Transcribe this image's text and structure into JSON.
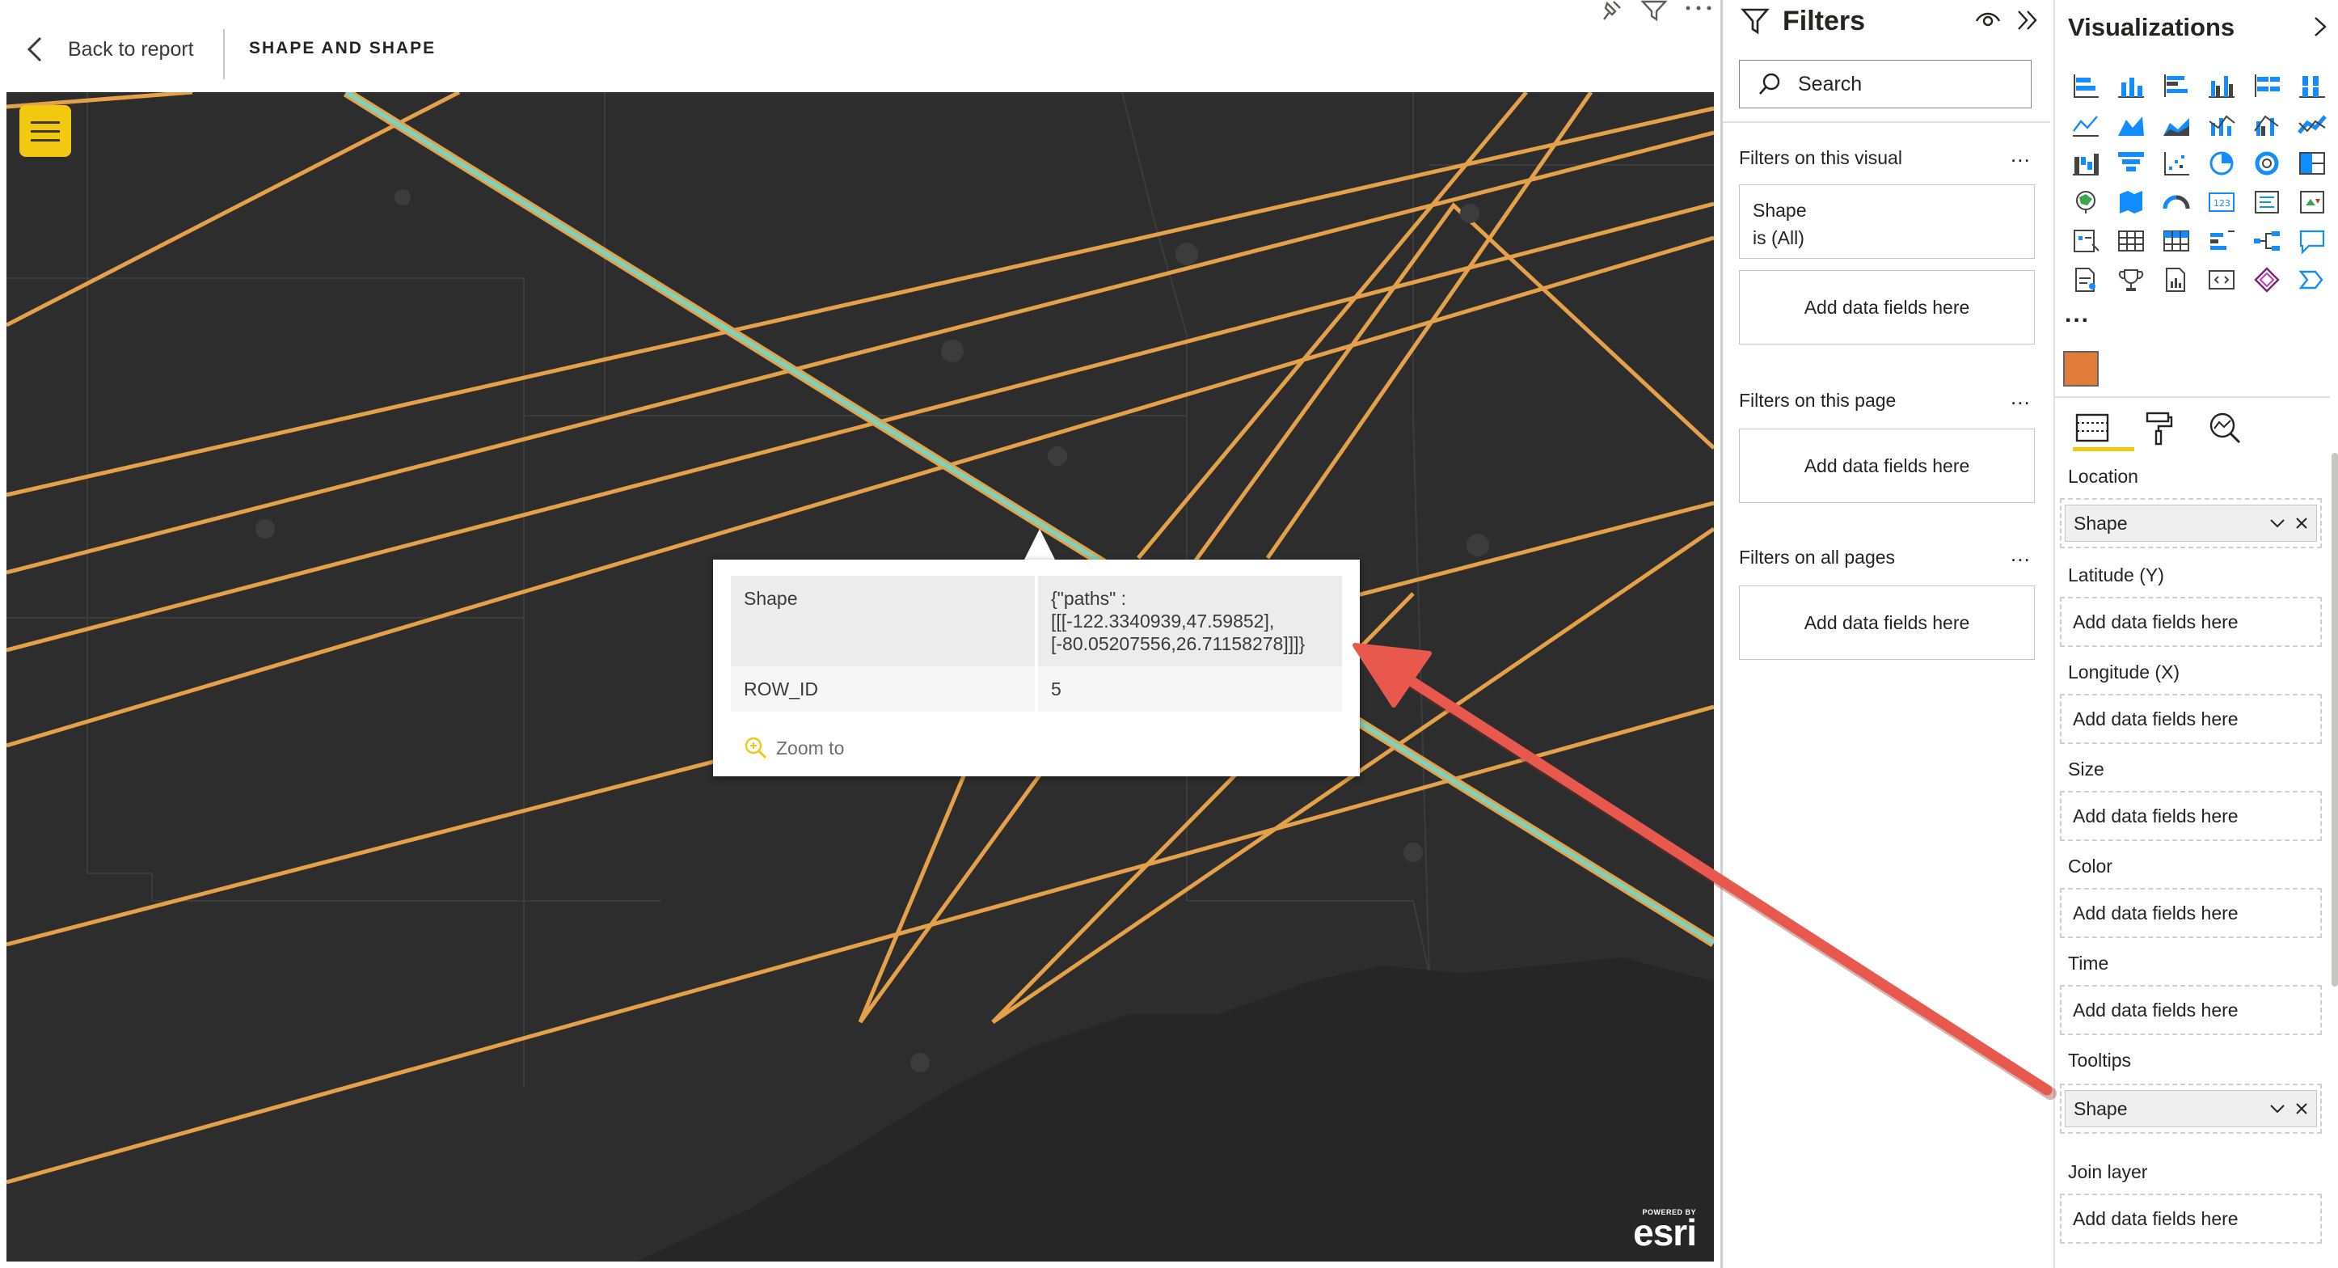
{
  "report_header": {
    "back_label": "Back to report",
    "page_title": "SHAPE AND SHAPE"
  },
  "visual_header_icons": [
    "pin-icon",
    "filter-icon",
    "more-options-icon"
  ],
  "map": {
    "attribution_small": "POWERED BY",
    "attribution_brand": "esri",
    "line_colors": {
      "orange": "#e5a14a",
      "teal": "#7fd1b9"
    },
    "popup": {
      "rows": [
        {
          "key": "Shape",
          "value_lines": [
            "{\"paths\" :",
            "[[[-122.3340939,47.59852],",
            "[-80.05207556,26.71158278]]]}"
          ]
        },
        {
          "key": "ROW_ID",
          "value": "5"
        }
      ],
      "zoom_label": "Zoom to"
    }
  },
  "filters_pane": {
    "title": "Filters",
    "search_placeholder": "Search",
    "sections": [
      {
        "title": "Filters on this visual",
        "more": "...",
        "card": {
          "field": "Shape",
          "condition": "is (All)"
        },
        "drop": "Add data fields here"
      },
      {
        "title": "Filters on this page",
        "more": "...",
        "drop": "Add data fields here"
      },
      {
        "title": "Filters on all pages",
        "more": "...",
        "drop": "Add data fields here"
      }
    ]
  },
  "viz_pane": {
    "title": "Visualizations",
    "more": "...",
    "wells": [
      {
        "label": "Location",
        "field": "Shape"
      },
      {
        "label": "Latitude (Y)",
        "drop": "Add data fields here"
      },
      {
        "label": "Longitude (X)",
        "drop": "Add data fields here"
      },
      {
        "label": "Size",
        "drop": "Add data fields here"
      },
      {
        "label": "Color",
        "drop": "Add data fields here"
      },
      {
        "label": "Time",
        "drop": "Add data fields here"
      },
      {
        "label": "Tooltips",
        "field": "Shape"
      },
      {
        "label": "Join layer",
        "drop": "Add data fields here"
      }
    ],
    "accent_color": "#f2c811"
  },
  "annotation": {
    "arrow_color": "#e8584c"
  }
}
